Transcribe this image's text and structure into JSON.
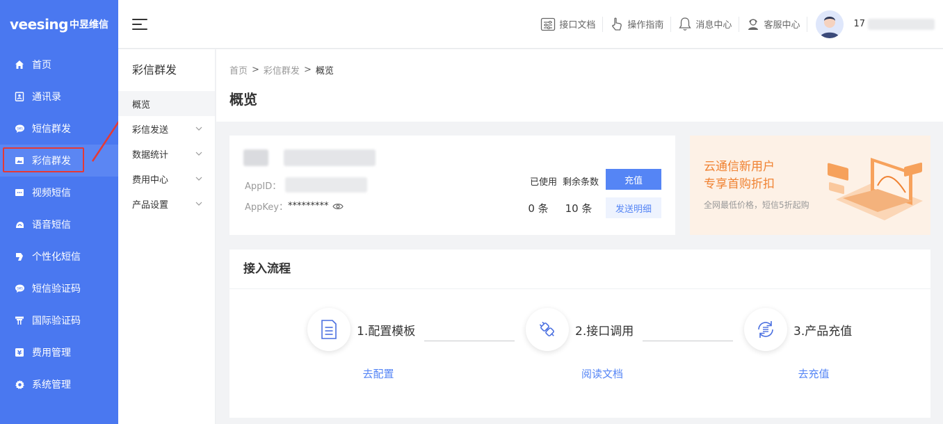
{
  "brand": {
    "logo_en": "veesing",
    "logo_cn": "中昱维信"
  },
  "sidebar": {
    "items": [
      {
        "label": "首页",
        "icon": "home-icon"
      },
      {
        "label": "通讯录",
        "icon": "contacts-icon"
      },
      {
        "label": "短信群发",
        "icon": "sms-icon"
      },
      {
        "label": "彩信群发",
        "icon": "mms-icon",
        "active": true
      },
      {
        "label": "视频短信",
        "icon": "video-sms-icon"
      },
      {
        "label": "语音短信",
        "icon": "voice-sms-icon"
      },
      {
        "label": "个性化短信",
        "icon": "personalized-sms-icon"
      },
      {
        "label": "短信验证码",
        "icon": "sms-code-icon"
      },
      {
        "label": "国际验证码",
        "icon": "international-code-icon"
      },
      {
        "label": "费用管理",
        "icon": "yuan-icon"
      },
      {
        "label": "系统管理",
        "icon": "gear-icon"
      }
    ]
  },
  "header": {
    "links": [
      {
        "label": "接口文档",
        "icon": "api-doc-icon"
      },
      {
        "label": "操作指南",
        "icon": "guide-hand-icon"
      },
      {
        "label": "消息中心",
        "icon": "bell-icon"
      },
      {
        "label": "客服中心",
        "icon": "customer-service-icon"
      }
    ],
    "phone_prefix": "17"
  },
  "submenu": {
    "title": "彩信群发",
    "items": [
      {
        "label": "概览",
        "expandable": false,
        "active": true
      },
      {
        "label": "彩信发送",
        "expandable": true
      },
      {
        "label": "数据统计",
        "expandable": true
      },
      {
        "label": "费用中心",
        "expandable": true
      },
      {
        "label": "产品设置",
        "expandable": true
      }
    ]
  },
  "breadcrumb": {
    "home": "首页",
    "parent": "彩信群发",
    "current": "概览",
    "separator": ">"
  },
  "page_title": "概览",
  "app_card": {
    "appid_label": "AppID：",
    "appkey_label": "AppKey：",
    "appkey_value": "*********",
    "used_label": "已使用",
    "remaining_label": "剩余条数",
    "used_value": "0 条",
    "remaining_value": "10 条",
    "recharge_button": "充值",
    "detail_button": "发送明细"
  },
  "promo": {
    "line1": "云通信新用户",
    "line2": "专享首购折扣",
    "sub": "全网最低价格，短信5折起购"
  },
  "flow": {
    "title": "接入流程",
    "steps": [
      {
        "label": "1.配置模板",
        "link": "去配置",
        "icon": "document-icon"
      },
      {
        "label": "2.接口调用",
        "link": "阅读文档",
        "icon": "plug-icon"
      },
      {
        "label": "3.产品充值",
        "link": "去充值",
        "icon": "refresh-icon"
      }
    ]
  },
  "colors": {
    "sidebar": "#4a78f0",
    "primary": "#5585f5",
    "promo_text": "#f08232",
    "highlight": "#e53935"
  }
}
